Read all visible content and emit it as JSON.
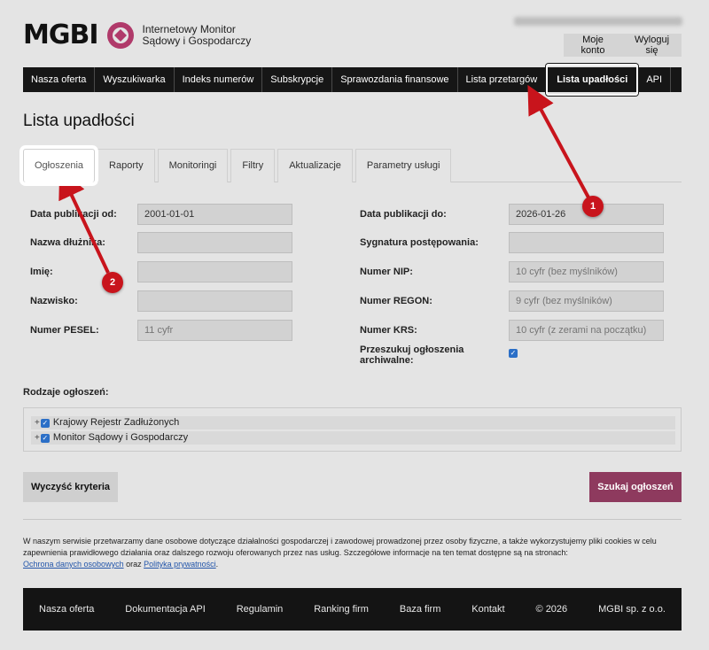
{
  "header": {
    "logo_text": "MGBI",
    "tagline_line1": "Internetowy Monitor",
    "tagline_line2": "Sądowy i Gospodarczy",
    "account_button": "Moje konto",
    "logout_button": "Wyloguj się"
  },
  "nav": {
    "items": [
      "Nasza oferta",
      "Wyszukiwarka",
      "Indeks numerów",
      "Subskrypcje",
      "Sprawozdania finansowe",
      "Lista przetargów",
      "Lista upadłości",
      "API"
    ],
    "active": "Lista upadłości"
  },
  "page": {
    "title": "Lista upadłości"
  },
  "tabs": {
    "items": [
      "Ogłoszenia",
      "Raporty",
      "Monitoringi",
      "Filtry",
      "Aktualizacje",
      "Parametry usługi"
    ],
    "active": "Ogłoszenia"
  },
  "form": {
    "left": [
      {
        "label": "Data publikacji od:",
        "value": "2001-01-01",
        "placeholder": ""
      },
      {
        "label": "Nazwa dłużnika:",
        "value": "",
        "placeholder": ""
      },
      {
        "label": "Imię:",
        "value": "",
        "placeholder": ""
      },
      {
        "label": "Nazwisko:",
        "value": "",
        "placeholder": ""
      },
      {
        "label": "Numer PESEL:",
        "value": "",
        "placeholder": "11 cyfr"
      }
    ],
    "right": [
      {
        "label": "Data publikacji do:",
        "value": "2026-01-26",
        "placeholder": ""
      },
      {
        "label": "Sygnatura postępowania:",
        "value": "",
        "placeholder": ""
      },
      {
        "label": "Numer NIP:",
        "value": "",
        "placeholder": "10 cyfr (bez myślników)"
      },
      {
        "label": "Numer REGON:",
        "value": "",
        "placeholder": "9 cyfr (bez myślników)"
      },
      {
        "label": "Numer KRS:",
        "value": "",
        "placeholder": "10 cyfr (z zerami na początku)"
      }
    ],
    "archive_label_line1": "Przeszukuj ogłoszenia",
    "archive_label_line2": "archiwalne:",
    "archive_checked": true
  },
  "types": {
    "label": "Rodzaje ogłoszeń:",
    "items": [
      "Krajowy Rejestr Zadłużonych",
      "Monitor Sądowy i Gospodarczy"
    ]
  },
  "actions": {
    "clear": "Wyczyść kryteria",
    "search": "Szukaj ogłoszeń"
  },
  "notice": {
    "text": "W naszym serwisie przetwarzamy dane osobowe dotyczące działalności gospodarczej i zawodowej prowadzonej przez osoby fizyczne, a także wykorzystujemy pliki cookies w celu zapewnienia prawidłowego działania oraz dalszego rozwoju oferowanych przez nas usług. Szczegółowe informacje na ten temat dostępne są na stronach:",
    "link1": "Ochrona danych osobowych",
    "joiner": "oraz",
    "link2": "Polityka prywatności",
    "end": "."
  },
  "footer": {
    "items": [
      "Nasza oferta",
      "Dokumentacja API",
      "Regulamin",
      "Ranking firm",
      "Baza firm",
      "Kontakt",
      "© 2026",
      "MGBI sp. z o.o."
    ]
  },
  "annotations": {
    "badge1": "1",
    "badge2": "2"
  },
  "colors": {
    "accent": "#8e3a5e",
    "nav_bg": "#161616",
    "annotation_red": "#c8141c"
  }
}
